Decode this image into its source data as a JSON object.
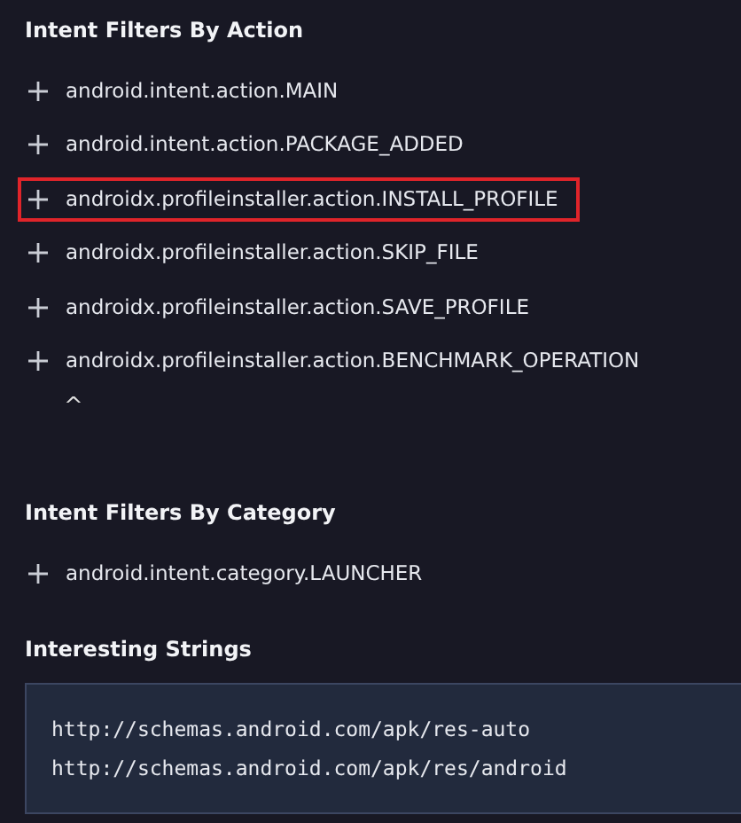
{
  "sections": [
    {
      "title": "Intent Filters By Action",
      "items": [
        {
          "label": "android.intent.action.MAIN",
          "highlighted": false
        },
        {
          "label": "android.intent.action.PACKAGE_ADDED",
          "highlighted": false
        },
        {
          "label": "androidx.profileinstaller.action.INSTALL_PROFILE",
          "highlighted": true
        },
        {
          "label": "androidx.profileinstaller.action.SKIP_FILE",
          "highlighted": false
        },
        {
          "label": "androidx.profileinstaller.action.SAVE_PROFILE",
          "highlighted": false
        },
        {
          "label": "androidx.profileinstaller.action.BENCHMARK_OPERATION",
          "highlighted": false
        }
      ],
      "collapse_toggle": "^"
    },
    {
      "title": "Intent Filters By Category",
      "items": [
        {
          "label": "android.intent.category.LAUNCHER",
          "highlighted": false
        }
      ]
    },
    {
      "title": "Interesting Strings",
      "code_lines": [
        "http://schemas.android.com/apk/res-auto",
        "http://schemas.android.com/apk/res/android"
      ]
    }
  ]
}
